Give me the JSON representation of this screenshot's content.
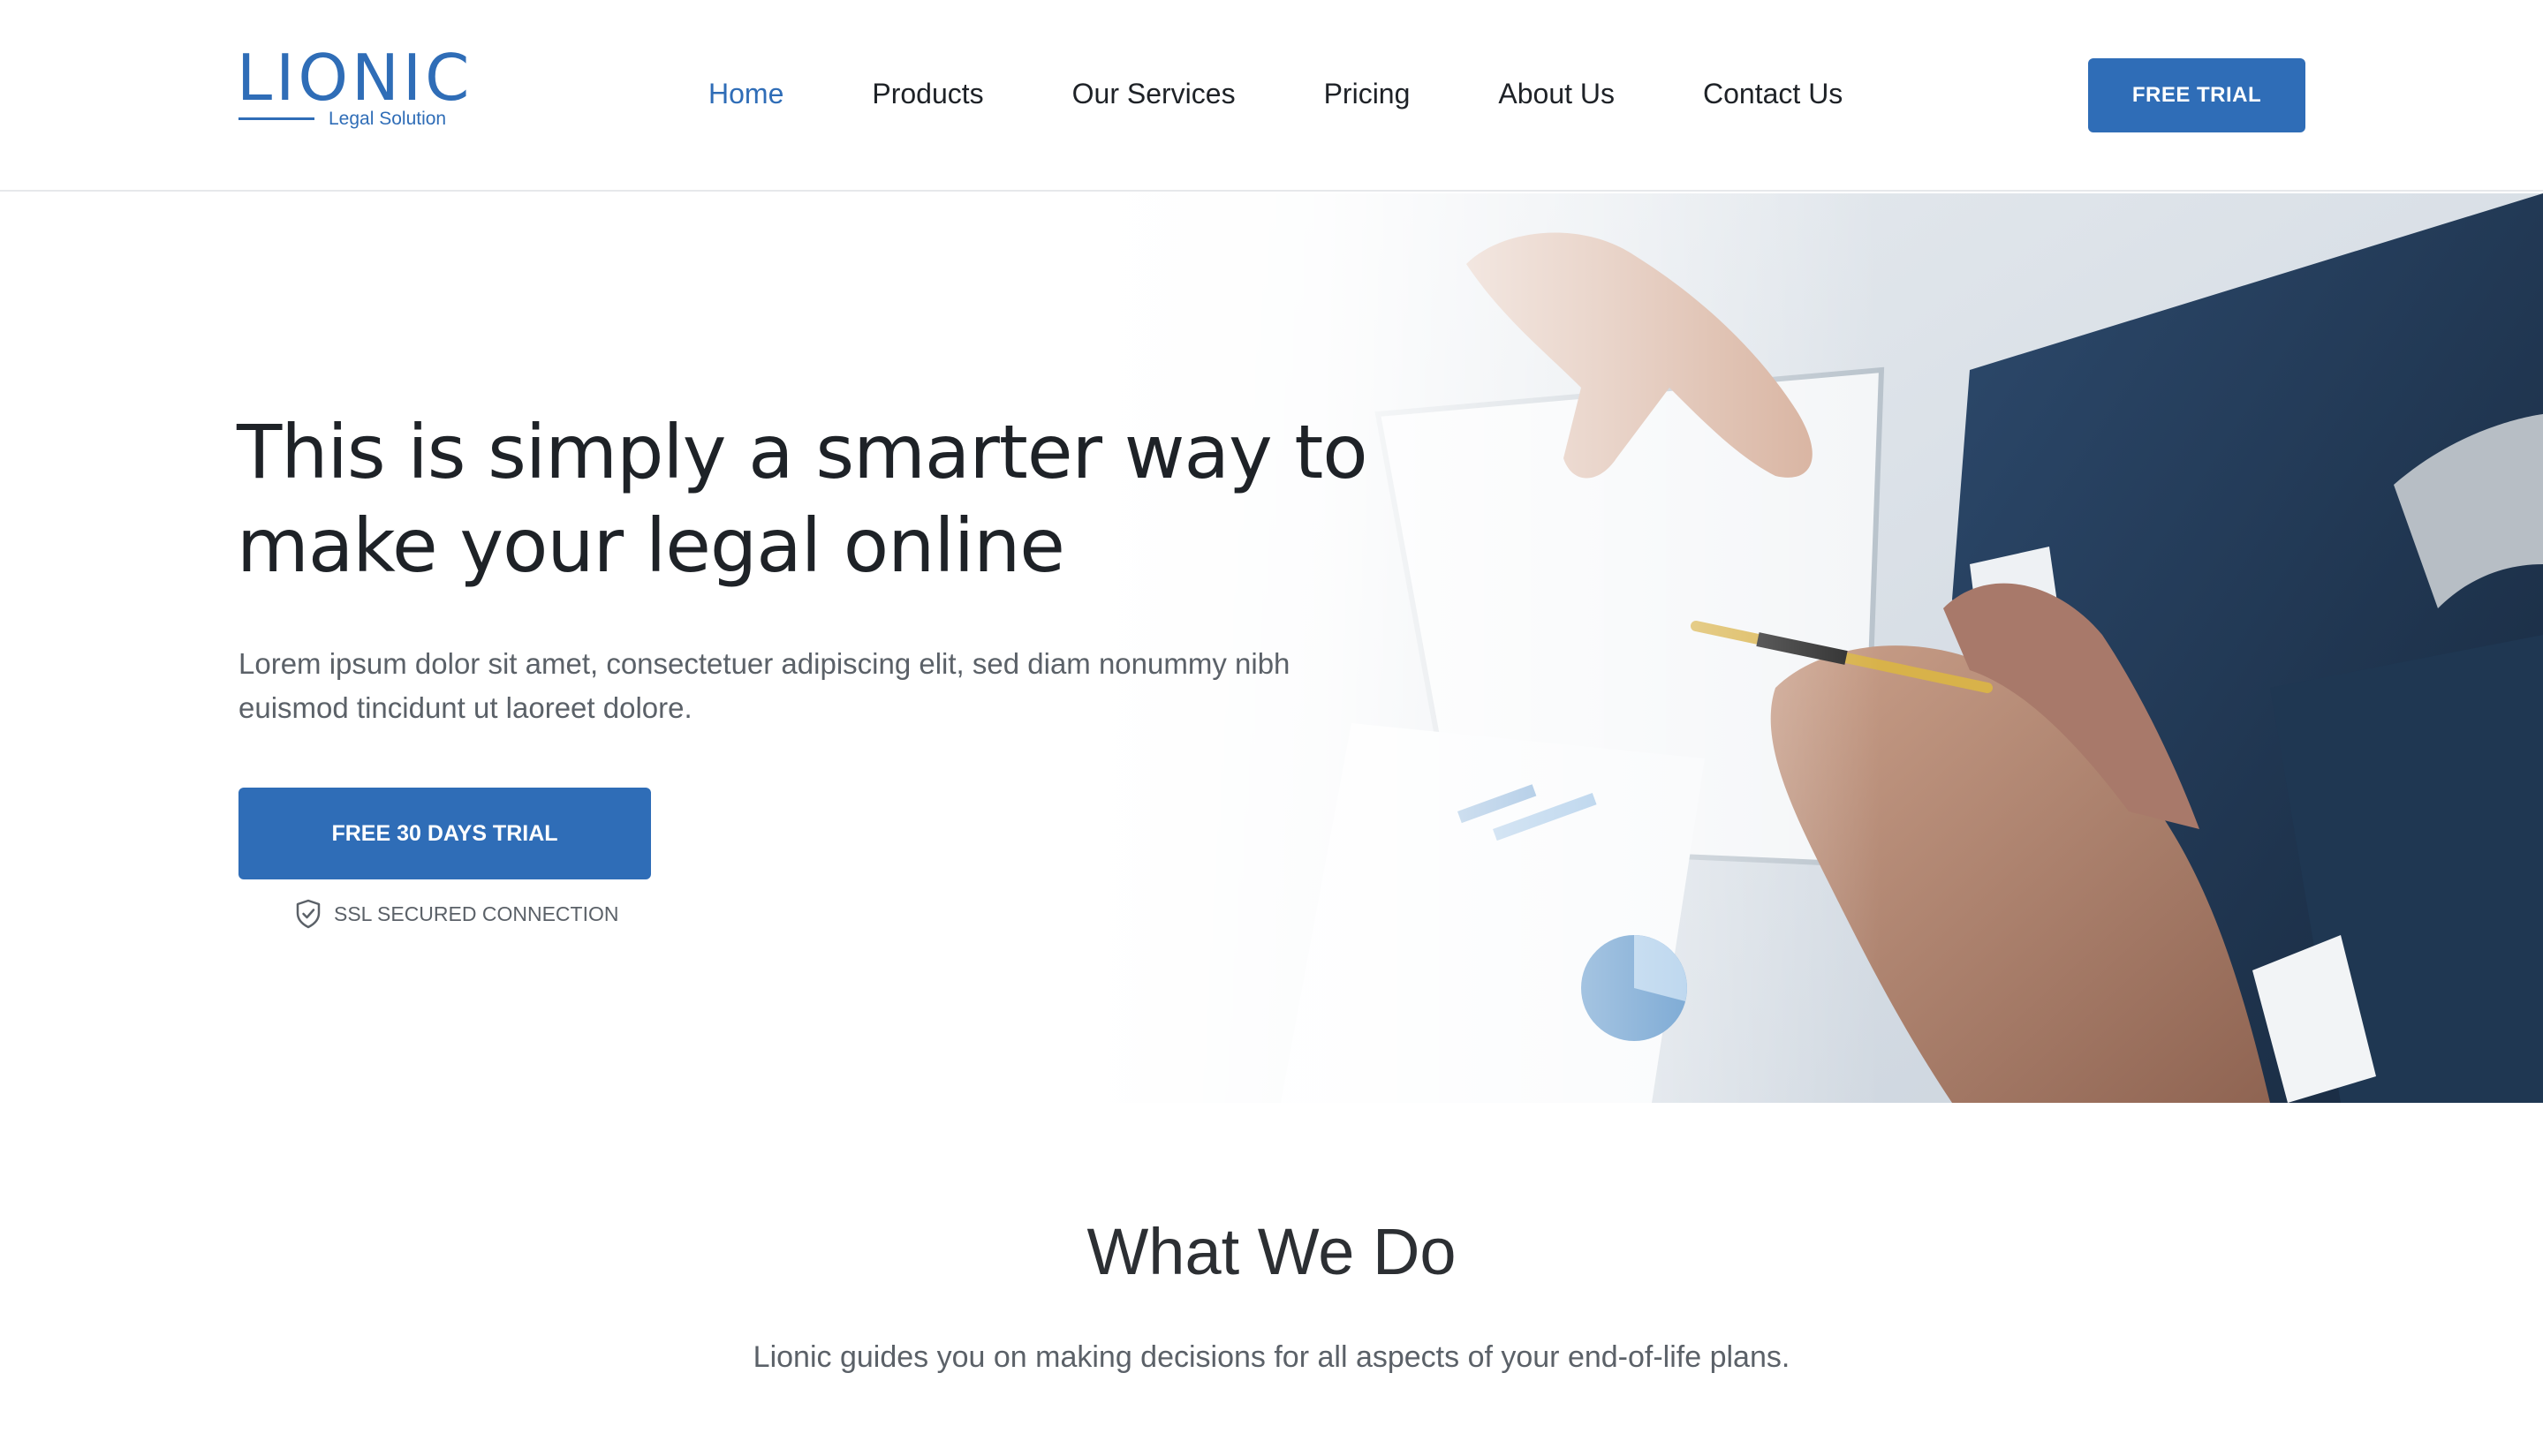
{
  "brand": {
    "name": "LIONIC",
    "tagline": "Legal Solution",
    "accent_color": "#2f6db7"
  },
  "nav": {
    "items": [
      {
        "label": "Home",
        "active": true
      },
      {
        "label": "Products",
        "active": false
      },
      {
        "label": "Our Services",
        "active": false
      },
      {
        "label": "Pricing",
        "active": false
      },
      {
        "label": "About Us",
        "active": false
      },
      {
        "label": "Contact Us",
        "active": false
      }
    ],
    "cta_label": "FREE TRIAL"
  },
  "hero": {
    "title": "This is simply a smarter way to make your legal online",
    "description": "Lorem ipsum dolor sit amet, consectetuer adipiscing elit, sed diam nonummy nibh euismod tincidunt ut laoreet dolore.",
    "cta_label": "FREE 30 DAYS TRIAL",
    "ssl_label": "SSL SECURED CONNECTION",
    "ssl_icon": "shield-check-icon"
  },
  "what_we_do": {
    "title": "What We Do",
    "subtitle": "Lionic guides you on making decisions for all aspects of your end-of-life plans."
  }
}
